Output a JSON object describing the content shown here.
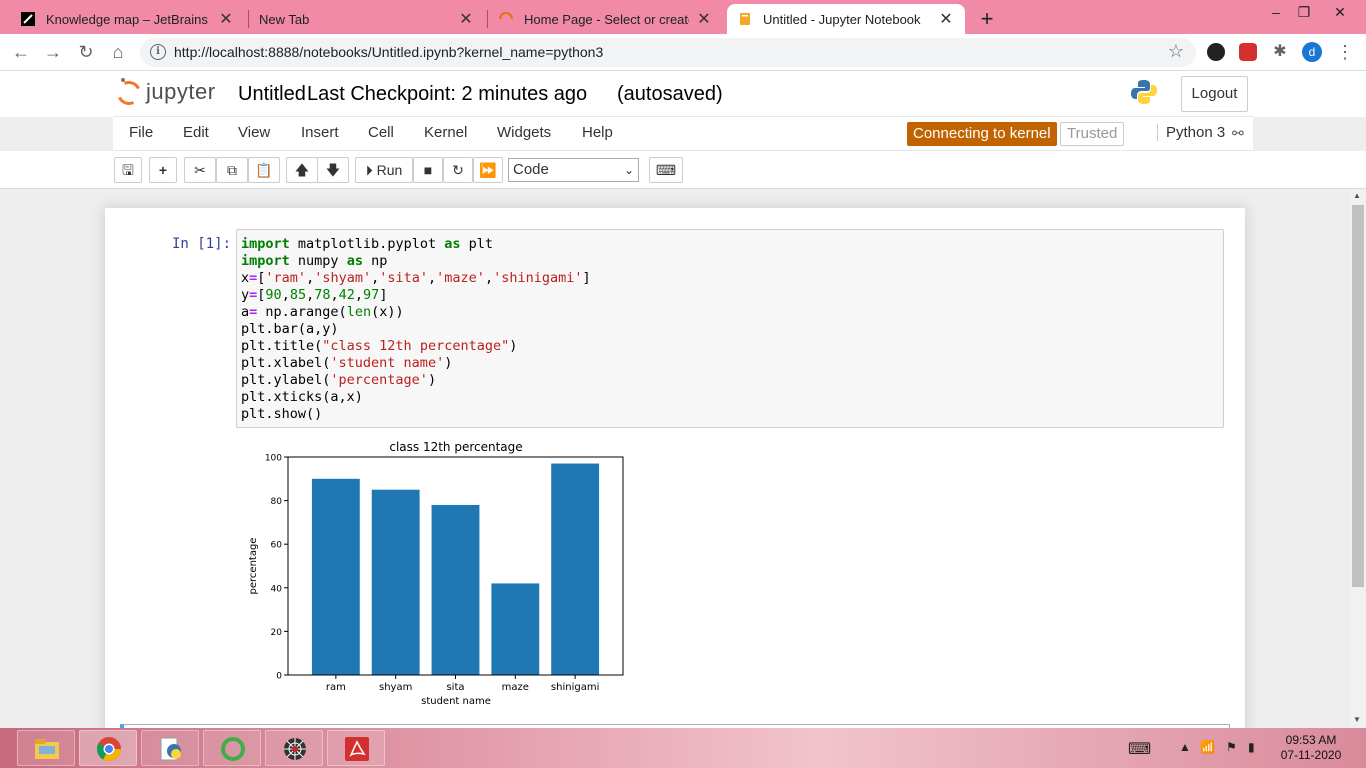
{
  "browser": {
    "tabs": [
      {
        "title": "Knowledge map – JetBrains Acad",
        "active": false
      },
      {
        "title": "New Tab",
        "active": false
      },
      {
        "title": "Home Page - Select or create a n",
        "active": false
      },
      {
        "title": "Untitled - Jupyter Notebook",
        "active": true
      }
    ],
    "url": "http://localhost:8888/notebooks/Untitled.ipynb?kernel_name=python3",
    "profile_initial": "d"
  },
  "jupyter": {
    "logo_text": "jupyter",
    "notebook_name": "Untitled",
    "checkpoint": "Last Checkpoint: 2 minutes ago",
    "autosave": "(autosaved)",
    "logout": "Logout",
    "menu": [
      "File",
      "Edit",
      "View",
      "Insert",
      "Cell",
      "Kernel",
      "Widgets",
      "Help"
    ],
    "kernel_status": "Connecting to kernel",
    "trusted": "Trusted",
    "kernel_name": "Python 3",
    "run_label": "Run",
    "cell_type": "Code"
  },
  "cell": {
    "prompt": "In [1]:",
    "code": [
      "import matplotlib.pyplot as plt",
      "import numpy as np",
      "x=['ram','shyam','sita','maze','shinigami']",
      "y=[90,85,78,42,97]",
      "a= np.arange(len(x))",
      "plt.bar(a,y)",
      "plt.title(\"class 12th percentage\")",
      "plt.xlabel('student name')",
      "plt.ylabel('percentage')",
      "plt.xticks(a,x)",
      "plt.show()"
    ]
  },
  "chart_data": {
    "type": "bar",
    "title": "class 12th percentage",
    "xlabel": "student name",
    "ylabel": "percentage",
    "categories": [
      "ram",
      "shyam",
      "sita",
      "maze",
      "shinigami"
    ],
    "values": [
      90,
      85,
      78,
      42,
      97
    ],
    "ylim": [
      0,
      100
    ],
    "yticks": [
      0,
      20,
      40,
      60,
      80,
      100
    ],
    "color": "#1f77b4",
    "grid": false
  },
  "taskbar": {
    "time": "09:53 AM",
    "date": "07-11-2020"
  }
}
